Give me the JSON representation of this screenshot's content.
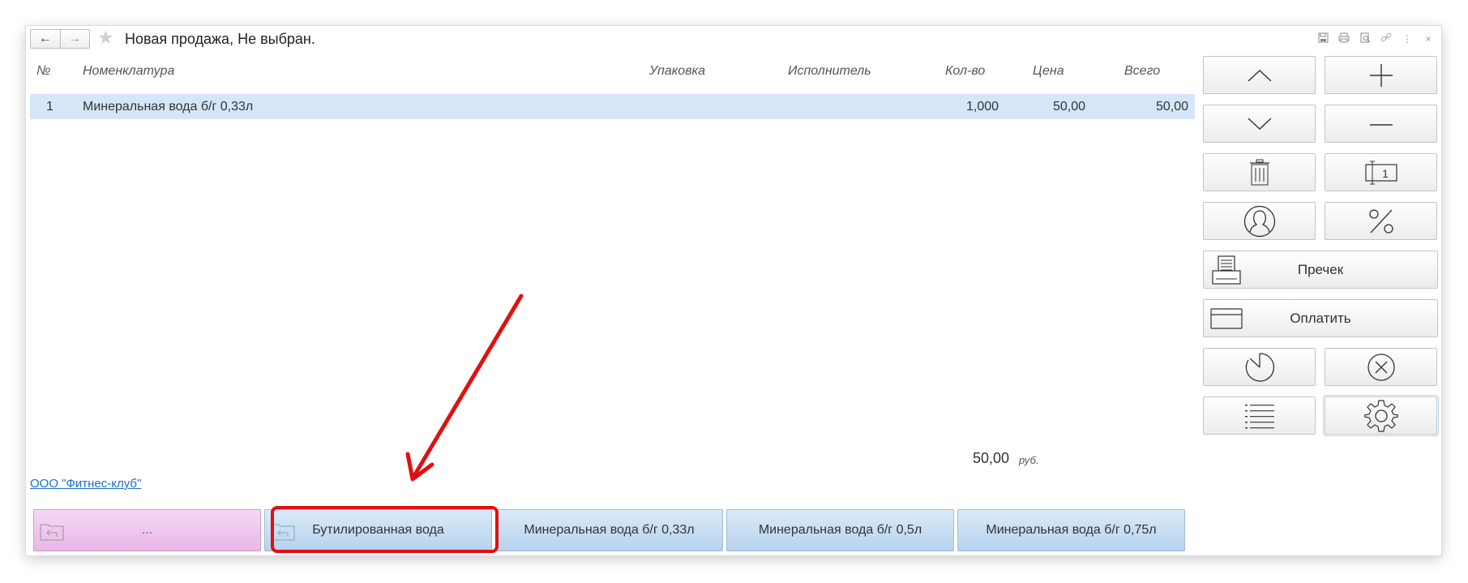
{
  "window": {
    "title": "Новая продажа, Не выбран.",
    "icons": [
      "save-icon",
      "print-icon",
      "preview-icon",
      "link-icon",
      "more-icon",
      "close-icon"
    ],
    "nav_back": "←",
    "nav_forward": "→"
  },
  "table": {
    "columns": [
      "№",
      "Номенклатура",
      "Упаковка",
      "Исполнитель",
      "Кол-во",
      "Цена",
      "Всего"
    ],
    "rows": [
      {
        "num": "1",
        "name": "Минеральная вода б/г 0,33л",
        "pack": "",
        "executor": "",
        "qty": "1,000",
        "price": "50,00",
        "total": "50,00"
      }
    ]
  },
  "summary": {
    "total": "50,00",
    "currency": "руб."
  },
  "organization": "ООО \"Фитнес-клуб\"",
  "panel": {
    "qty_badge": "1",
    "precheck_label": "Пречек",
    "pay_label": "Оплатить"
  },
  "quick_buttons": [
    {
      "label": "...",
      "type": "folder",
      "color": "pink"
    },
    {
      "label": "Бутилированная вода",
      "type": "folder",
      "color": "blue",
      "highlighted": true
    },
    {
      "label": "Минеральная вода б/г 0,33л",
      "type": "item",
      "color": "blue"
    },
    {
      "label": "Минеральная вода б/г 0,5л",
      "type": "item",
      "color": "blue"
    },
    {
      "label": "Минеральная вода б/г 0,75л",
      "type": "item",
      "color": "blue"
    }
  ],
  "colors": {
    "row_selected": "#d5e6f8",
    "highlight": "#e01010",
    "link": "#1a6fd0"
  }
}
